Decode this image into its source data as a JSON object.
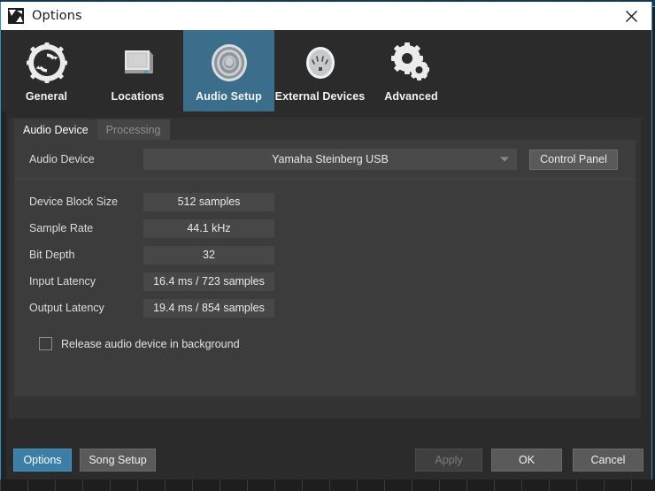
{
  "window": {
    "title": "Options",
    "icon": "app-logo-icon",
    "close_label": "close-icon"
  },
  "icon_tabs": [
    {
      "label": "General",
      "icon": "gear-refresh-icon",
      "selected": false
    },
    {
      "label": "Locations",
      "icon": "hard-drive-icon",
      "selected": false
    },
    {
      "label": "Audio Setup",
      "icon": "speaker-icon",
      "selected": true
    },
    {
      "label": "External Devices",
      "icon": "midi-connector-icon",
      "selected": false
    },
    {
      "label": "Advanced",
      "icon": "double-gear-icon",
      "selected": false
    }
  ],
  "sub_tabs": [
    {
      "label": "Audio Device",
      "active": true
    },
    {
      "label": "Processing",
      "active": false
    }
  ],
  "device_row": {
    "label": "Audio Device",
    "selected_value": "Yamaha Steinberg USB",
    "dropdown_icon": "chevron-down-icon",
    "control_panel_label": "Control Panel"
  },
  "info_rows": [
    {
      "label": "Device Block Size",
      "value": "512 samples"
    },
    {
      "label": "Sample Rate",
      "value": "44.1 kHz"
    },
    {
      "label": "Bit Depth",
      "value": "32"
    },
    {
      "label": "Input Latency",
      "value": "16.4 ms / 723 samples"
    },
    {
      "label": "Output Latency",
      "value": "19.4 ms / 854 samples"
    }
  ],
  "checkbox": {
    "label": "Release audio device in background",
    "checked": false
  },
  "footer": {
    "options_label": "Options",
    "song_setup_label": "Song Setup",
    "apply_label": "Apply",
    "apply_enabled": false,
    "ok_label": "OK",
    "cancel_label": "Cancel"
  },
  "colors": {
    "accent": "#3a7fa8",
    "selected_tab": "#3a6e8a",
    "dialog_border": "#2e8fc4",
    "panel": "#3c3c3c",
    "body": "#333333",
    "titlebar": "#ffffff"
  }
}
